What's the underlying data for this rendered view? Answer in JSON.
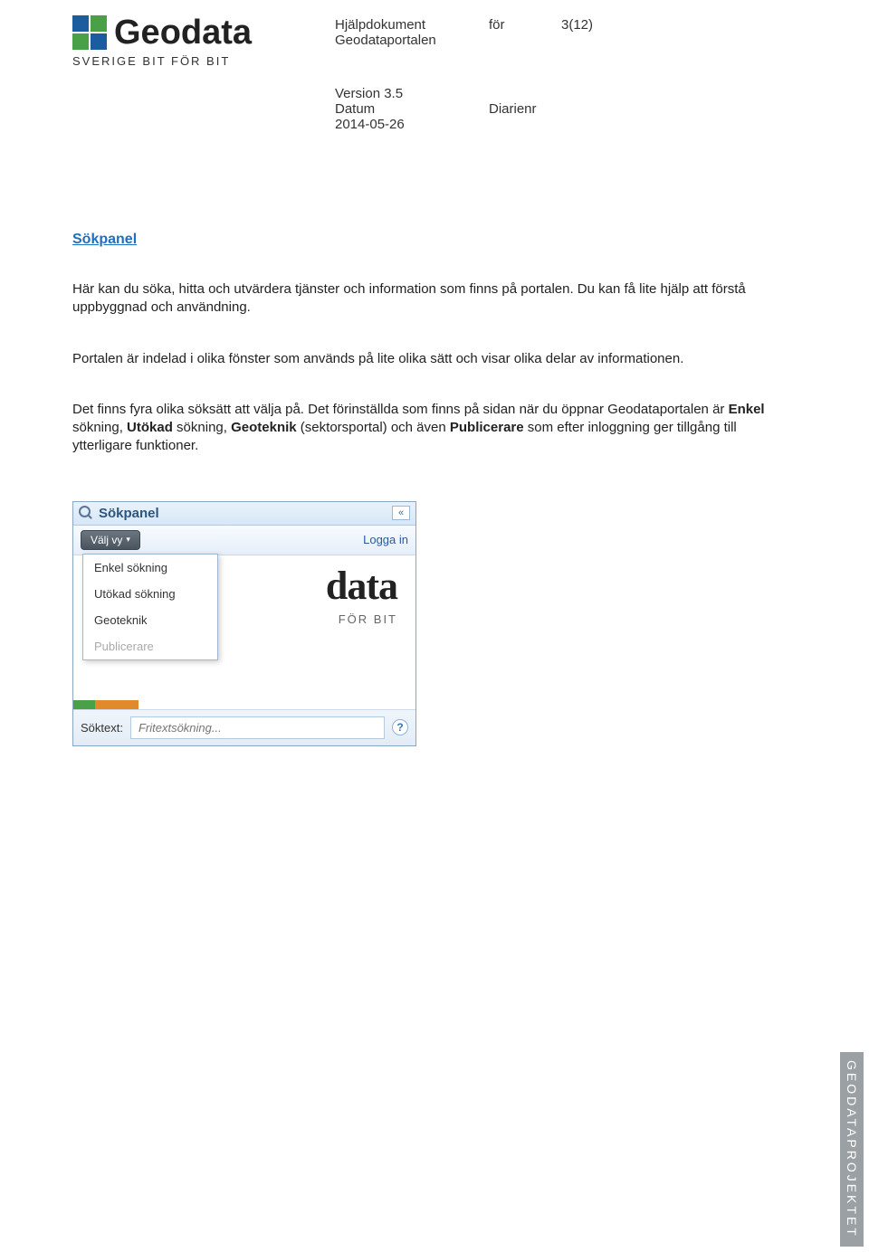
{
  "header": {
    "logo_text": "Geodata",
    "logo_tagline": "SVERIGE BIT FÖR BIT",
    "doc_title_1": "Hjälpdokument",
    "doc_title_for": "för",
    "doc_title_2": "Geodataportalen",
    "page_indicator": "3(12)",
    "version_line": "Version 3.5",
    "date_label": "Datum",
    "date_value": "2014-05-26",
    "diarienr_label": "Diarienr"
  },
  "section": {
    "title": "Sökpanel",
    "para1": "Här kan du söka, hitta och utvärdera tjänster och information som finns på portalen. Du kan få lite hjälp att förstå uppbyggnad och användning.",
    "para2": "Portalen är indelad i olika fönster som används på lite olika sätt och visar olika delar av informationen.",
    "para3_pre": "Det finns fyra olika söksätt att välja på. Det förinställda som finns på sidan när du öppnar Geodataportalen är ",
    "p3_b1": "Enkel",
    "p3_t1": " sökning, ",
    "p3_b2": "Utökad",
    "p3_t2": " sökning, ",
    "p3_b3": "Geoteknik",
    "p3_t3": " (sektorsportal) och även ",
    "p3_b4": "Publicerare",
    "p3_t4": " som efter inloggning ger tillgång till ytterligare funktioner."
  },
  "shot": {
    "panel_title": "Sökpanel",
    "collapse_glyph": "«",
    "select_view": "Välj vy",
    "select_tri": "▾",
    "login": "Logga in",
    "menu": {
      "m1": "Enkel sökning",
      "m2": "Utökad sökning",
      "m3": "Geoteknik",
      "m4": "Publicerare"
    },
    "bg_logo_1": "data",
    "bg_logo_2": "FÖR BIT",
    "search_label": "Söktext:",
    "search_placeholder": "Fritextsökning...",
    "help_glyph": "?"
  },
  "side_brand": "GEODATAPROJEKTET"
}
